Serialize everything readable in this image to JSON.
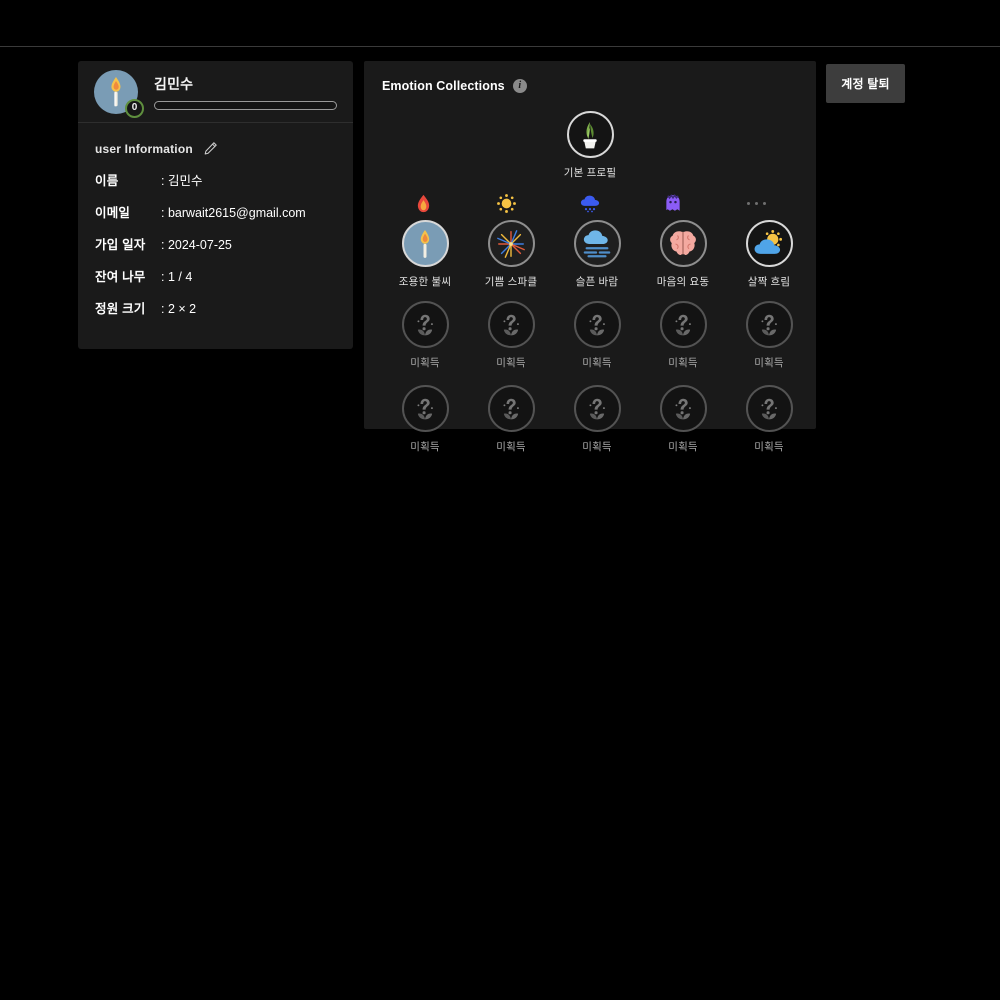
{
  "topbar": {
    "present": true
  },
  "profile": {
    "avatar_icon": "candle-icon",
    "level_badge": "0",
    "name": "김민수",
    "xp_percent": 0,
    "info_title": "user Information",
    "edit_icon": "pencil-icon",
    "rows": [
      {
        "label": "이름",
        "value": ": 김민수"
      },
      {
        "label": "이메일",
        "value": ": barwait2615@gmail.com"
      },
      {
        "label": "가입 일자",
        "value": ": 2024-07-25"
      },
      {
        "label": "잔여 나무",
        "value": ": 1 / 4"
      },
      {
        "label": "정원 크기",
        "value": ": 2 × 2"
      }
    ]
  },
  "collections": {
    "title": "Emotion Collections",
    "info_icon": "info-icon",
    "info_glyph": "i",
    "default_profile": {
      "label": "기본 프로필",
      "icon": "potted-plant-icon"
    },
    "categories": [
      {
        "icon": "fire-icon"
      },
      {
        "icon": "sun-icon"
      },
      {
        "icon": "rain-cloud-icon"
      },
      {
        "icon": "angry-face-icon"
      },
      {
        "icon": "ellipsis-icon"
      }
    ],
    "unlocked": [
      {
        "label": "조용한 불씨",
        "icon": "candle-icon"
      },
      {
        "label": "기쁨 스파클",
        "icon": "fireworks-icon"
      },
      {
        "label": "슬픈 바람",
        "icon": "foggy-cloud-icon"
      },
      {
        "label": "마음의 요동",
        "icon": "brain-icon"
      },
      {
        "label": "살짝 흐림",
        "icon": "sun-behind-cloud-icon"
      }
    ],
    "locked_row_1": [
      {
        "label": "미획득",
        "icon": "locked-seedling-icon"
      },
      {
        "label": "미획득",
        "icon": "locked-seedling-icon"
      },
      {
        "label": "미획득",
        "icon": "locked-seedling-icon"
      },
      {
        "label": "미획득",
        "icon": "locked-seedling-icon"
      },
      {
        "label": "미획득",
        "icon": "locked-seedling-icon"
      }
    ],
    "locked_row_2": [
      {
        "label": "미획득",
        "icon": "locked-seedling-icon"
      },
      {
        "label": "미획득",
        "icon": "locked-seedling-icon"
      },
      {
        "label": "미획득",
        "icon": "locked-seedling-icon"
      },
      {
        "label": "미획득",
        "icon": "locked-seedling-icon"
      },
      {
        "label": "미획득",
        "icon": "locked-seedling-icon"
      }
    ]
  },
  "actions": {
    "withdraw_label": "계정 탈퇴"
  },
  "colors": {
    "page_bg": "#000000",
    "card_bg": "#1a1a1a",
    "divider": "#3a3a3a",
    "accent_green": "#5f8f3e",
    "button_bg": "#3d3d3d",
    "text_primary": "#ffffff",
    "text_muted": "#a9a9a9"
  }
}
